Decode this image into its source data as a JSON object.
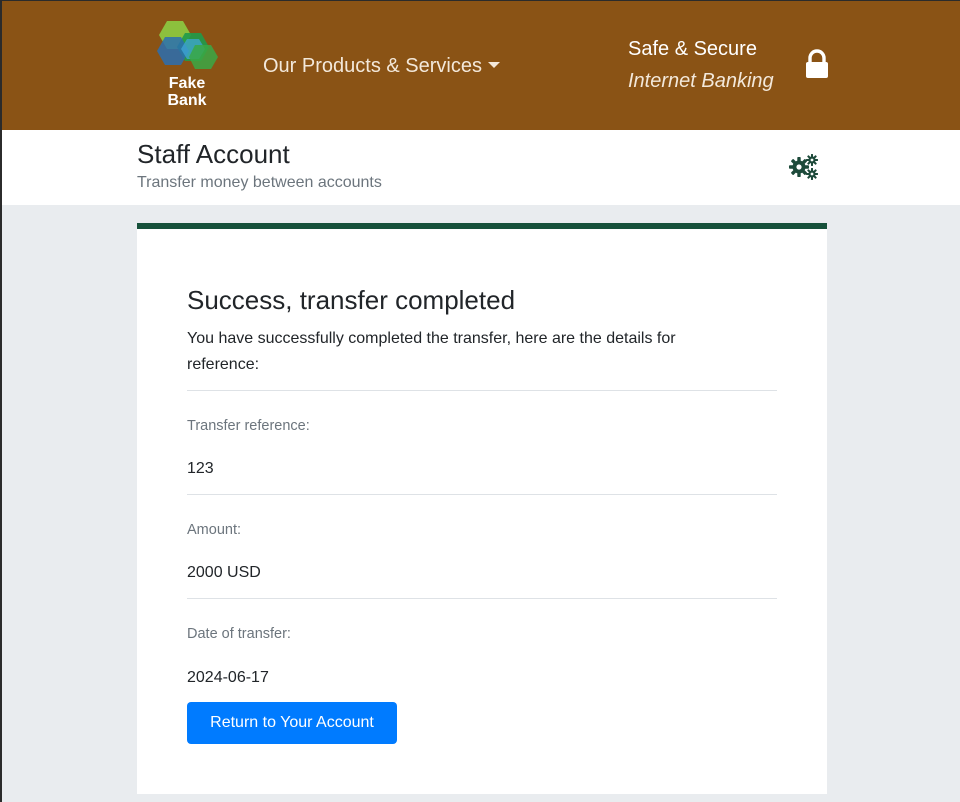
{
  "brand": {
    "logo_line1": "Fake",
    "logo_line2": "Bank"
  },
  "nav": {
    "products_label": "Our Products & Services"
  },
  "tagline": {
    "line1": "Safe & Secure",
    "line2": "Internet Banking"
  },
  "header": {
    "title": "Staff Account",
    "subtitle": "Transfer money between accounts"
  },
  "card": {
    "title": "Success, transfer completed",
    "message": "You have successfully completed the transfer, here are the details for reference:",
    "fields": [
      {
        "label": "Transfer reference:",
        "value": "123"
      },
      {
        "label": "Amount:",
        "value": "2000 USD"
      },
      {
        "label": "Date of transfer:",
        "value": "2024-06-17"
      }
    ],
    "button_label": "Return to Your Account"
  },
  "colors": {
    "navbar": "#8a5315",
    "card_accent": "#17513b",
    "button": "#007bff",
    "gear_icon": "#1d4a3a"
  },
  "icons": {
    "logo": "fake-bank-logo",
    "dropdown": "caret-down-icon",
    "security": "lock-icon",
    "settings": "gears-icon"
  }
}
